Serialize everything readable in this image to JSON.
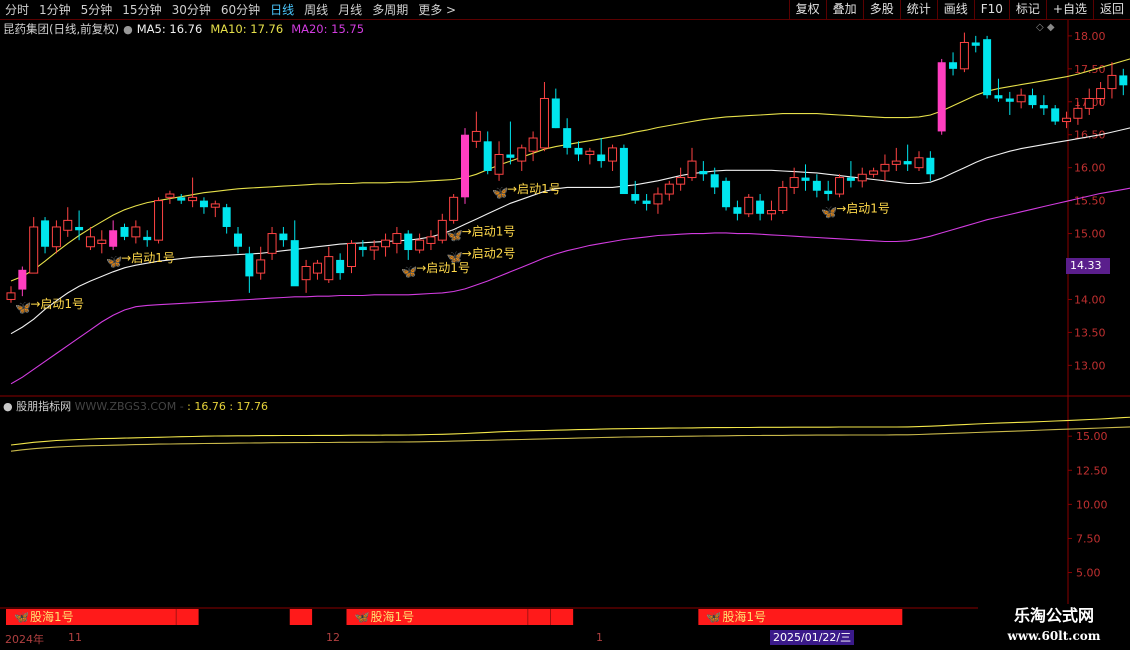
{
  "toolbar": {
    "periods": [
      "分时",
      "1分钟",
      "5分钟",
      "15分钟",
      "30分钟",
      "60分钟",
      "日线",
      "周线",
      "月线",
      "多周期",
      "更多"
    ],
    "active_period": "日线",
    "more_arrow": ">",
    "buttons": [
      "复权",
      "叠加",
      "多股",
      "统计",
      "画线",
      "F10",
      "标记",
      "+自选",
      "返回"
    ]
  },
  "title": {
    "stock": "昆药集团(日线,前复权)",
    "ma5": "MA5: 16.76",
    "ma10": "MA10: 17.76",
    "ma20": "MA20: 15.75",
    "gear": "●"
  },
  "panel_icons": "◇  ◆",
  "price_tag": "14.33",
  "indicator": {
    "name": "股朋指标网",
    "watermark": "WWW.ZBGS3.COM - ",
    "values": ": 16.76 : 17.76"
  },
  "dates": {
    "labels": [
      {
        "text": "2024年"
      },
      {
        "text": "11"
      },
      {
        "text": "12"
      },
      {
        "text": "1"
      }
    ],
    "highlight": "2025/01/22/三"
  },
  "logo": {
    "line1": "乐淘公式网",
    "line2": "www.60lt.com"
  },
  "colors": {
    "up": "#ff4444",
    "down": "#00e5ee",
    "limit": "#ff3ec0",
    "ma_white": "#f0f0f0",
    "ma_yellow": "#e6e04a",
    "ma_purple": "#d23ce0",
    "grid_red": "#8a0000",
    "label_yellow": "#ffd94a"
  },
  "chart_data": {
    "type": "candlestick",
    "y_axis": {
      "ticks": [
        18.0,
        17.5,
        17.0,
        16.5,
        16.0,
        15.5,
        15.0,
        14.5,
        14.0,
        13.5,
        13.0
      ],
      "range": [
        12.55,
        18.15
      ]
    },
    "indicator_axis": {
      "ticks": [
        15.0,
        12.5,
        10.0,
        7.5,
        5.0
      ],
      "range": [
        2.4,
        17.8
      ]
    },
    "candles": [
      [
        14.0,
        14.2,
        13.95,
        14.1
      ],
      [
        14.15,
        14.5,
        14.05,
        14.45
      ],
      [
        14.4,
        15.25,
        14.4,
        15.1
      ],
      [
        15.2,
        15.25,
        14.7,
        14.8
      ],
      [
        14.8,
        15.2,
        14.7,
        15.1
      ],
      [
        15.05,
        15.4,
        14.95,
        15.2
      ],
      [
        15.1,
        15.35,
        14.9,
        15.05
      ],
      [
        14.8,
        15.1,
        14.75,
        14.95
      ],
      [
        14.85,
        15.05,
        14.7,
        14.9
      ],
      [
        14.8,
        15.2,
        14.75,
        15.05
      ],
      [
        15.1,
        15.15,
        14.9,
        14.95
      ],
      [
        14.95,
        15.2,
        14.85,
        15.1
      ],
      [
        14.95,
        15.05,
        14.8,
        14.9
      ],
      [
        14.9,
        15.55,
        14.85,
        15.5
      ],
      [
        15.55,
        15.65,
        15.45,
        15.6
      ],
      [
        15.55,
        15.6,
        15.45,
        15.5
      ],
      [
        15.5,
        15.85,
        15.4,
        15.55
      ],
      [
        15.5,
        15.55,
        15.3,
        15.4
      ],
      [
        15.4,
        15.5,
        15.25,
        15.45
      ],
      [
        15.4,
        15.45,
        15.0,
        15.1
      ],
      [
        15.0,
        15.1,
        14.7,
        14.8
      ],
      [
        14.7,
        14.8,
        14.1,
        14.35
      ],
      [
        14.4,
        14.8,
        14.3,
        14.6
      ],
      [
        14.7,
        15.1,
        14.6,
        15.0
      ],
      [
        15.0,
        15.1,
        14.8,
        14.9
      ],
      [
        14.9,
        15.2,
        14.35,
        14.2
      ],
      [
        14.3,
        14.6,
        14.1,
        14.5
      ],
      [
        14.4,
        14.6,
        14.3,
        14.55
      ],
      [
        14.3,
        14.8,
        14.25,
        14.65
      ],
      [
        14.6,
        14.7,
        14.3,
        14.4
      ],
      [
        14.5,
        14.9,
        14.4,
        14.85
      ],
      [
        14.8,
        14.9,
        14.65,
        14.75
      ],
      [
        14.75,
        14.9,
        14.6,
        14.8
      ],
      [
        14.8,
        15.0,
        14.65,
        14.9
      ],
      [
        14.85,
        15.1,
        14.7,
        15.0
      ],
      [
        15.0,
        15.05,
        14.6,
        14.75
      ],
      [
        14.75,
        15.0,
        14.7,
        14.9
      ],
      [
        14.85,
        15.05,
        14.75,
        14.95
      ],
      [
        14.9,
        15.3,
        14.85,
        15.2
      ],
      [
        15.2,
        15.6,
        15.15,
        15.55
      ],
      [
        15.55,
        16.6,
        15.45,
        16.5
      ],
      [
        16.4,
        16.85,
        16.3,
        16.55
      ],
      [
        16.4,
        16.55,
        15.9,
        15.95
      ],
      [
        15.9,
        16.4,
        15.8,
        16.2
      ],
      [
        16.2,
        16.7,
        16.05,
        16.15
      ],
      [
        16.1,
        16.35,
        15.95,
        16.3
      ],
      [
        16.25,
        16.55,
        16.1,
        16.45
      ],
      [
        16.3,
        17.3,
        16.25,
        17.05
      ],
      [
        17.05,
        17.2,
        16.6,
        16.6
      ],
      [
        16.6,
        16.75,
        16.2,
        16.3
      ],
      [
        16.3,
        16.4,
        16.1,
        16.2
      ],
      [
        16.2,
        16.3,
        16.05,
        16.25
      ],
      [
        16.2,
        16.45,
        16.0,
        16.1
      ],
      [
        16.1,
        16.35,
        15.95,
        16.3
      ],
      [
        16.3,
        16.35,
        15.7,
        15.6
      ],
      [
        15.6,
        15.8,
        15.45,
        15.5
      ],
      [
        15.5,
        15.6,
        15.35,
        15.45
      ],
      [
        15.45,
        15.7,
        15.3,
        15.6
      ],
      [
        15.6,
        15.8,
        15.5,
        15.75
      ],
      [
        15.75,
        16.0,
        15.65,
        15.85
      ],
      [
        15.85,
        16.3,
        15.8,
        16.1
      ],
      [
        15.95,
        16.1,
        15.8,
        15.9
      ],
      [
        15.9,
        16.0,
        15.6,
        15.7
      ],
      [
        15.8,
        15.85,
        15.35,
        15.4
      ],
      [
        15.4,
        15.5,
        15.2,
        15.3
      ],
      [
        15.3,
        15.6,
        15.25,
        15.55
      ],
      [
        15.5,
        15.6,
        15.2,
        15.3
      ],
      [
        15.3,
        15.5,
        15.2,
        15.35
      ],
      [
        15.35,
        15.8,
        15.3,
        15.7
      ],
      [
        15.7,
        16.0,
        15.6,
        15.85
      ],
      [
        15.85,
        16.05,
        15.65,
        15.8
      ],
      [
        15.8,
        15.9,
        15.55,
        15.65
      ],
      [
        15.65,
        15.8,
        15.5,
        15.6
      ],
      [
        15.6,
        15.9,
        15.55,
        15.85
      ],
      [
        15.85,
        16.1,
        15.7,
        15.8
      ],
      [
        15.8,
        16.0,
        15.7,
        15.9
      ],
      [
        15.9,
        16.0,
        15.85,
        15.95
      ],
      [
        15.95,
        16.2,
        15.8,
        16.05
      ],
      [
        16.05,
        16.3,
        15.95,
        16.1
      ],
      [
        16.1,
        16.35,
        15.95,
        16.05
      ],
      [
        16.0,
        16.25,
        15.95,
        16.15
      ],
      [
        16.15,
        16.25,
        15.8,
        15.9
      ],
      [
        16.55,
        17.65,
        16.5,
        17.6
      ],
      [
        17.6,
        17.75,
        17.4,
        17.5
      ],
      [
        17.5,
        18.05,
        17.45,
        17.9
      ],
      [
        17.9,
        18.0,
        17.75,
        17.85
      ],
      [
        17.95,
        18.0,
        17.05,
        17.1
      ],
      [
        17.1,
        17.35,
        17.0,
        17.05
      ],
      [
        17.05,
        17.15,
        16.8,
        17.0
      ],
      [
        17.0,
        17.2,
        16.9,
        17.1
      ],
      [
        17.1,
        17.2,
        16.9,
        16.95
      ],
      [
        16.95,
        17.1,
        16.8,
        16.9
      ],
      [
        16.9,
        16.95,
        16.65,
        16.7
      ],
      [
        16.7,
        16.85,
        16.6,
        16.75
      ],
      [
        16.75,
        17.0,
        16.65,
        16.9
      ],
      [
        16.9,
        17.2,
        16.8,
        17.05
      ],
      [
        17.05,
        17.3,
        16.95,
        17.2
      ],
      [
        17.2,
        17.6,
        17.05,
        17.4
      ],
      [
        17.4,
        17.5,
        17.1,
        17.25
      ],
      [
        17.25,
        17.35,
        17.0,
        17.05
      ]
    ],
    "ma_white": [
      13.48,
      13.58,
      13.7,
      13.85,
      13.98,
      14.1,
      14.2,
      14.28,
      14.35,
      14.42,
      14.48,
      14.52,
      14.55,
      14.58,
      14.6,
      14.62,
      14.64,
      14.65,
      14.66,
      14.67,
      14.68,
      14.69,
      14.7,
      14.72,
      14.74,
      14.76,
      14.78,
      14.8,
      14.82,
      14.84,
      14.85,
      14.86,
      14.87,
      14.88,
      14.89,
      14.9,
      14.92,
      14.95,
      15.0,
      15.06,
      15.14,
      15.22,
      15.3,
      15.38,
      15.46,
      15.52,
      15.58,
      15.64,
      15.68,
      15.7,
      15.7,
      15.7,
      15.7,
      15.7,
      15.72,
      15.74,
      15.77,
      15.8,
      15.84,
      15.88,
      15.91,
      15.93,
      15.95,
      15.96,
      15.96,
      15.96,
      15.96,
      15.96,
      15.95,
      15.94,
      15.93,
      15.92,
      15.9,
      15.88,
      15.86,
      15.84,
      15.82,
      15.8,
      15.78,
      15.76,
      15.76,
      15.78,
      15.84,
      15.92,
      16.0,
      16.08,
      16.15,
      16.2,
      16.25,
      16.29,
      16.32,
      16.35,
      16.38,
      16.41,
      16.44,
      16.47,
      16.5,
      16.54,
      16.58,
      16.62,
      16.67,
      16.72
    ],
    "ma_yellow": [
      14.28,
      14.35,
      14.45,
      14.58,
      14.72,
      14.85,
      14.97,
      15.08,
      15.18,
      15.28,
      15.36,
      15.42,
      15.47,
      15.5,
      15.53,
      15.56,
      15.59,
      15.62,
      15.64,
      15.66,
      15.68,
      15.69,
      15.7,
      15.71,
      15.72,
      15.73,
      15.74,
      15.75,
      15.75,
      15.76,
      15.76,
      15.77,
      15.77,
      15.77,
      15.78,
      15.78,
      15.79,
      15.8,
      15.81,
      15.82,
      15.85,
      15.9,
      15.97,
      16.04,
      16.1,
      16.16,
      16.22,
      16.28,
      16.32,
      16.35,
      16.38,
      16.41,
      16.44,
      16.47,
      16.5,
      16.54,
      16.57,
      16.61,
      16.64,
      16.67,
      16.7,
      16.73,
      16.75,
      16.77,
      16.78,
      16.79,
      16.8,
      16.81,
      16.82,
      16.82,
      16.82,
      16.82,
      16.81,
      16.8,
      16.79,
      16.78,
      16.77,
      16.76,
      16.76,
      16.76,
      16.77,
      16.8,
      16.86,
      16.94,
      17.02,
      17.1,
      17.16,
      17.2,
      17.23,
      17.26,
      17.29,
      17.32,
      17.35,
      17.38,
      17.42,
      17.47,
      17.52,
      17.57,
      17.62,
      17.67,
      17.72,
      17.78
    ],
    "ma_purple": [
      12.72,
      12.82,
      12.94,
      13.06,
      13.18,
      13.3,
      13.42,
      13.54,
      13.66,
      13.76,
      13.84,
      13.89,
      13.91,
      13.92,
      13.93,
      13.94,
      13.95,
      13.96,
      13.97,
      13.98,
      13.99,
      14.0,
      14.01,
      14.02,
      14.03,
      14.04,
      14.04,
      14.05,
      14.05,
      14.06,
      14.06,
      14.06,
      14.07,
      14.07,
      14.07,
      14.07,
      14.08,
      14.09,
      14.1,
      14.12,
      14.16,
      14.22,
      14.28,
      14.35,
      14.42,
      14.49,
      14.56,
      14.63,
      14.69,
      14.74,
      14.78,
      14.82,
      14.85,
      14.88,
      14.91,
      14.93,
      14.95,
      14.97,
      14.98,
      14.99,
      15.0,
      15.0,
      15.01,
      15.01,
      15.0,
      15.0,
      14.99,
      14.98,
      14.97,
      14.96,
      14.95,
      14.94,
      14.93,
      14.92,
      14.91,
      14.9,
      14.89,
      14.88,
      14.88,
      14.89,
      14.92,
      14.96,
      15.01,
      15.06,
      15.11,
      15.16,
      15.21,
      15.25,
      15.29,
      15.33,
      15.37,
      15.41,
      15.45,
      15.49,
      15.53,
      15.57,
      15.61,
      15.64,
      15.67,
      15.7,
      15.73,
      15.75
    ],
    "indicator_series": [
      {
        "name": "16.76",
        "values": [
          14.35,
          14.45,
          14.55,
          14.62,
          14.68,
          14.72,
          14.76,
          14.79,
          14.82,
          14.84,
          14.86,
          14.88,
          14.9,
          14.92,
          14.94,
          14.96,
          14.98,
          15.0,
          15.01,
          15.02,
          15.03,
          15.03,
          15.04,
          15.04,
          15.05,
          15.05,
          15.05,
          15.06,
          15.06,
          15.06,
          15.07,
          15.07,
          15.07,
          15.08,
          15.08,
          15.09,
          15.1,
          15.12,
          15.14,
          15.17,
          15.2,
          15.24,
          15.28,
          15.32,
          15.35,
          15.38,
          15.4,
          15.42,
          15.44,
          15.46,
          15.48,
          15.5,
          15.52,
          15.54,
          15.55,
          15.56,
          15.57,
          15.58,
          15.59,
          15.6,
          15.61,
          15.62,
          15.63,
          15.63,
          15.64,
          15.64,
          15.65,
          15.65,
          15.65,
          15.66,
          15.66,
          15.66,
          15.66,
          15.67,
          15.67,
          15.67,
          15.67,
          15.67,
          15.67,
          15.68,
          15.7,
          15.73,
          15.77,
          15.81,
          15.85,
          15.89,
          15.93,
          15.96,
          15.99,
          16.02,
          16.05,
          16.08,
          16.11,
          16.14,
          16.18,
          16.22,
          16.26,
          16.31,
          16.36,
          16.41,
          16.46,
          16.51
        ]
      },
      {
        "name": "17.76",
        "values": [
          13.9,
          14.0,
          14.08,
          14.15,
          14.2,
          14.24,
          14.27,
          14.3,
          14.32,
          14.34,
          14.36,
          14.38,
          14.4,
          14.42,
          14.43,
          14.44,
          14.45,
          14.46,
          14.47,
          14.48,
          14.49,
          14.5,
          14.51,
          14.52,
          14.52,
          14.53,
          14.53,
          14.54,
          14.54,
          14.55,
          14.55,
          14.56,
          14.56,
          14.57,
          14.57,
          14.58,
          14.59,
          14.6,
          14.62,
          14.64,
          14.66,
          14.68,
          14.7,
          14.72,
          14.74,
          14.76,
          14.78,
          14.8,
          14.82,
          14.84,
          14.86,
          14.88,
          14.9,
          14.92,
          14.94,
          14.95,
          14.96,
          14.97,
          14.98,
          14.99,
          15.0,
          15.01,
          15.02,
          15.03,
          15.04,
          15.05,
          15.05,
          15.06,
          15.06,
          15.07,
          15.07,
          15.08,
          15.08,
          15.08,
          15.09,
          15.09,
          15.09,
          15.09,
          15.1,
          15.1,
          15.12,
          15.15,
          15.18,
          15.21,
          15.24,
          15.27,
          15.3,
          15.33,
          15.36,
          15.39,
          15.42,
          15.45,
          15.48,
          15.51,
          15.54,
          15.57,
          15.6,
          15.63,
          15.66,
          15.69,
          15.72,
          15.75
        ]
      }
    ],
    "signals": [
      {
        "index": 1,
        "text": "→启动1号"
      },
      {
        "index": 9,
        "text": "→启动1号"
      },
      {
        "index": 35,
        "text": "→启动1号"
      },
      {
        "index": 39,
        "text": "→启动1号"
      },
      {
        "index": 39,
        "text": "→启动2号"
      },
      {
        "index": 43,
        "text": "→启动1号"
      },
      {
        "index": 72,
        "text": "→启动1号"
      }
    ],
    "bottom_signals": [
      {
        "start": 0,
        "end": 14,
        "label": "股海1号"
      },
      {
        "start": 15,
        "end": 16,
        "label": ""
      },
      {
        "start": 25,
        "end": 26,
        "label": ""
      },
      {
        "start": 30,
        "end": 45,
        "label": "股海1号"
      },
      {
        "start": 46,
        "end": 47,
        "label": ""
      },
      {
        "start": 48,
        "end": 49,
        "label": ""
      },
      {
        "start": 61,
        "end": 78,
        "label": "股海1号"
      }
    ]
  }
}
